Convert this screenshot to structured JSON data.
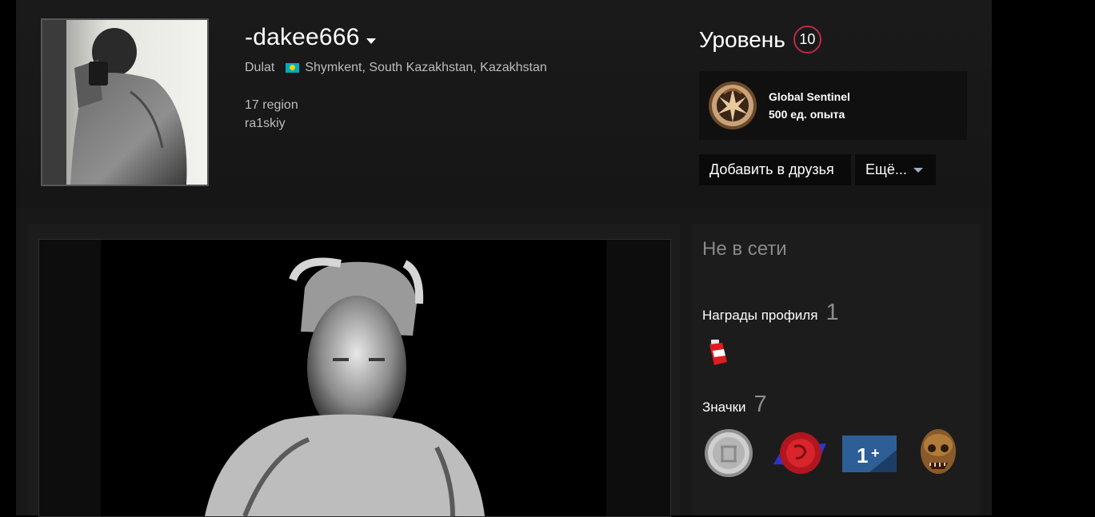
{
  "profile": {
    "persona_name": "-dakee666",
    "real_name": "Dulat",
    "location": "Shymkent, South Kazakhstan, Kazakhstan",
    "summary_lines": [
      "17 region",
      "ra1skiy"
    ]
  },
  "level": {
    "label": "Уровень",
    "value": "10"
  },
  "favorite_badge": {
    "name": "Global Sentinel",
    "xp": "500 ед. опыта"
  },
  "actions": {
    "add_friend": "Добавить в друзья",
    "more": "Ещё..."
  },
  "sidebar": {
    "status": "Не в сети",
    "awards_label": "Награды профиля",
    "awards_count": "1",
    "badges_label": "Значки",
    "badges_count": "7"
  },
  "icons": {
    "level_ring_color": "#c02942",
    "flag": "kazakhstan-flag-icon",
    "award": "award-icon",
    "badges": [
      "silver-coin-badge-icon",
      "red-seal-badge-icon",
      "years-of-service-badge-icon",
      "zombie-badge-icon"
    ]
  }
}
